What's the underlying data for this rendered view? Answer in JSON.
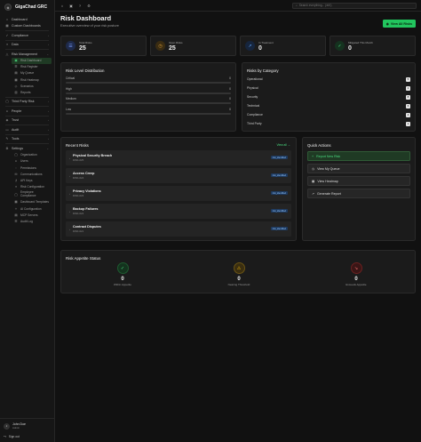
{
  "brand": {
    "name": "GigaChad GRC",
    "logo_icon": "shield-logo-icon"
  },
  "sidebar": {
    "items": [
      {
        "label": "Dashboard",
        "icon": "home-icon"
      },
      {
        "label": "Custom Dashboards",
        "icon": "grid-icon"
      },
      {
        "label": "Compliance",
        "icon": "check-icon"
      },
      {
        "label": "Data",
        "icon": "database-icon"
      },
      {
        "label": "Risk Management",
        "icon": "alert-icon"
      }
    ],
    "risk_sub": [
      "Risk Dashboard",
      "Risk Register",
      "My Queue",
      "Risk Heatmap",
      "Scenarios",
      "Reports"
    ],
    "items2": [
      {
        "label": "Third Party Risk"
      },
      {
        "label": "People"
      },
      {
        "label": "Trust"
      },
      {
        "label": "Audit"
      },
      {
        "label": "Tools"
      },
      {
        "label": "Settings"
      }
    ],
    "settings_sub": [
      "Organization",
      "Users",
      "Permissions",
      "Communications",
      "API Keys",
      "Risk Configuration",
      "Employee Compliance",
      "Dashboard Templates",
      "AI Configuration",
      "MCP Servers",
      "Audit Log"
    ],
    "user": {
      "initials": "J",
      "name": "John Doe",
      "role": "Admin"
    },
    "signout": "Sign out"
  },
  "topbar": {
    "search_placeholder": "Search everything... (⌘K)"
  },
  "header": {
    "title": "Risk Dashboard",
    "subtitle": "Executive overview of your risk posture",
    "view_all": "View All Risks"
  },
  "stats": [
    {
      "label": "Total Risks",
      "value": "25",
      "color": "#3b5bdb",
      "icon": "list-icon"
    },
    {
      "label": "Open Risks",
      "value": "25",
      "color": "#b7791f",
      "icon": "clock-icon"
    },
    {
      "label": "In Treatment",
      "value": "0",
      "color": "#2563eb",
      "icon": "trend-icon"
    },
    {
      "label": "Mitigated This Month",
      "value": "0",
      "color": "#16a34a",
      "icon": "check-icon"
    }
  ],
  "level_distribution": {
    "title": "Risk Level Distribution",
    "rows": [
      {
        "label": "Critical",
        "value": "0"
      },
      {
        "label": "High",
        "value": "0"
      },
      {
        "label": "Medium",
        "value": "0"
      },
      {
        "label": "Low",
        "value": "0"
      }
    ]
  },
  "categories": {
    "title": "Risks by Category",
    "rows": [
      {
        "label": "Operational",
        "value": "5"
      },
      {
        "label": "Physical",
        "value": "1"
      },
      {
        "label": "Security",
        "value": "8"
      },
      {
        "label": "Technical",
        "value": "6"
      },
      {
        "label": "Compliance",
        "value": "4"
      },
      {
        "label": "Third Party",
        "value": "1"
      }
    ]
  },
  "recent": {
    "title": "Recent Risks",
    "view_all": "View all →",
    "items": [
      {
        "name": "Physical Security Breach",
        "id": "RISK-025",
        "status": "risk_identified"
      },
      {
        "name": "Access Creep",
        "id": "RISK-024",
        "status": "risk_identified"
      },
      {
        "name": "Privacy Violations",
        "id": "RISK-023",
        "status": "risk_identified"
      },
      {
        "name": "Backup Failures",
        "id": "RISK-022",
        "status": "risk_identified"
      },
      {
        "name": "Contract Disputes",
        "id": "RISK-021",
        "status": "risk_identified"
      }
    ]
  },
  "quick_actions": {
    "title": "Quick Actions",
    "items": [
      {
        "label": "Report New Risk",
        "icon": "plus-icon"
      },
      {
        "label": "View My Queue",
        "icon": "queue-icon"
      },
      {
        "label": "View Heatmap",
        "icon": "grid-icon"
      },
      {
        "label": "Generate Report",
        "icon": "chart-icon"
      }
    ]
  },
  "appetite": {
    "title": "Risk Appetite Status",
    "items": [
      {
        "value": "0",
        "label": "Within Appetite",
        "color": "#16a34a"
      },
      {
        "value": "0",
        "label": "Nearing Threshold",
        "color": "#ca8a04"
      },
      {
        "value": "0",
        "label": "Exceeds Appetite",
        "color": "#dc2626"
      }
    ]
  }
}
